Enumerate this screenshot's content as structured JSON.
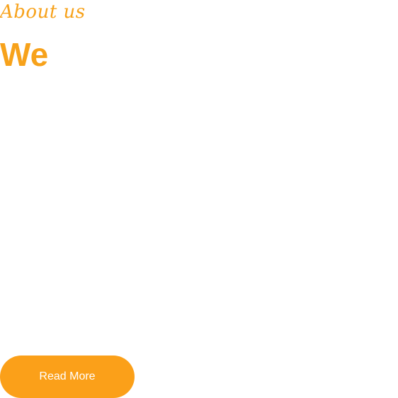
{
  "about": {
    "eyebrow": "About us",
    "headline": "We"
  },
  "cta": {
    "label": "Read More"
  },
  "colors": {
    "accent": "#f7a21b",
    "button_bg": "#fba019",
    "button_text": "#ffffff",
    "background": "#ffffff"
  }
}
